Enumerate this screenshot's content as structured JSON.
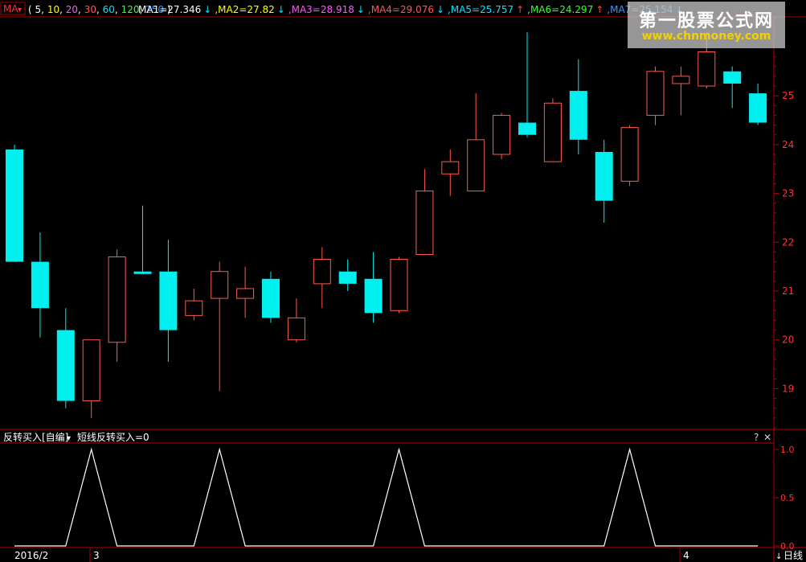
{
  "indicator_bar": {
    "selector": "MA",
    "params_open": "(",
    "params": [
      "5",
      "10",
      "20",
      "30",
      "60",
      "120",
      "250"
    ],
    "params_close": ")",
    "ma": [
      {
        "label": "MA1=27.346",
        "arrow": "↓",
        "color": "#ffffff",
        "arrow_color": "#00e5ff"
      },
      {
        "label": ",MA2=27.82",
        "arrow": "↓",
        "color": "#ffff00",
        "arrow_color": "#00e5ff"
      },
      {
        "label": ",MA3=28.918",
        "arrow": "↓",
        "color": "#ff55ff",
        "arrow_color": "#00e5ff"
      },
      {
        "label": ",MA4=29.076",
        "arrow": "↓",
        "color": "#ff5555",
        "arrow_color": "#00e5ff"
      },
      {
        "label": ",MA5=25.757",
        "arrow": "↑",
        "color": "#00e5ff",
        "arrow_color": "#ff4444"
      },
      {
        "label": ",MA6=24.297",
        "arrow": "↑",
        "color": "#33ff33",
        "arrow_color": "#ff4444"
      },
      {
        "label": ",MA7=25.154",
        "arrow": "↓",
        "color": "#3399ff",
        "arrow_color": "#00e5ff"
      }
    ],
    "param_colors": [
      "#ffffff",
      "#ffff00",
      "#ff55ff",
      "#ff5555",
      "#00e5ff",
      "#33ff33",
      "#3399ff"
    ]
  },
  "watermark": {
    "line1": "第一股票公式网",
    "line2": "www.chnmoney.com"
  },
  "sub_panel": {
    "title": "反转买入[自编]",
    "dropdown": "▾",
    "formula": "短线反转买入=0",
    "help": "?",
    "close": "✕"
  },
  "footer": {
    "labels": [
      "2016/2",
      "3",
      "4"
    ],
    "period": "日线",
    "period_arrow": "🡇"
  },
  "colors": {
    "up": "#ff5a4a",
    "down": "#00f0f0",
    "grid": "#b00000",
    "axis_text": "#ff3333",
    "signal": "#ffffff"
  },
  "chart_data": [
    {
      "type": "candlestick",
      "y_ticks": [
        "19",
        "20",
        "21",
        "22",
        "23",
        "24",
        "25"
      ],
      "ylim": [
        18.2,
        26.6
      ],
      "candles": [
        {
          "o": 23.9,
          "h": 24.0,
          "l": 21.6,
          "c": 21.6
        },
        {
          "o": 21.6,
          "h": 22.2,
          "l": 20.05,
          "c": 20.65
        },
        {
          "o": 20.2,
          "h": 20.65,
          "l": 18.6,
          "c": 18.75
        },
        {
          "o": 18.75,
          "h": 20.0,
          "l": 18.4,
          "c": 20.0
        },
        {
          "o": 19.95,
          "h": 21.85,
          "l": 19.55,
          "c": 21.7
        },
        {
          "o": 21.4,
          "h": 22.75,
          "l": 21.35,
          "c": 21.35
        },
        {
          "o": 21.4,
          "h": 22.05,
          "l": 19.55,
          "c": 20.2
        },
        {
          "o": 20.5,
          "h": 21.05,
          "l": 20.4,
          "c": 20.8
        },
        {
          "o": 20.85,
          "h": 21.6,
          "l": 18.95,
          "c": 21.4
        },
        {
          "o": 20.85,
          "h": 21.5,
          "l": 20.45,
          "c": 21.05
        },
        {
          "o": 21.25,
          "h": 21.4,
          "l": 20.35,
          "c": 20.45
        },
        {
          "o": 20.0,
          "h": 20.85,
          "l": 19.95,
          "c": 20.45
        },
        {
          "o": 21.15,
          "h": 21.9,
          "l": 20.65,
          "c": 21.65
        },
        {
          "o": 21.4,
          "h": 21.65,
          "l": 21.0,
          "c": 21.15
        },
        {
          "o": 21.25,
          "h": 21.8,
          "l": 20.35,
          "c": 20.55
        },
        {
          "o": 20.6,
          "h": 21.7,
          "l": 20.55,
          "c": 21.65
        },
        {
          "o": 21.75,
          "h": 23.5,
          "l": 21.75,
          "c": 23.05
        },
        {
          "o": 23.4,
          "h": 23.9,
          "l": 22.95,
          "c": 23.65
        },
        {
          "o": 23.05,
          "h": 25.05,
          "l": 23.05,
          "c": 24.1
        },
        {
          "o": 23.8,
          "h": 24.65,
          "l": 23.7,
          "c": 24.6
        },
        {
          "o": 24.45,
          "h": 26.3,
          "l": 24.15,
          "c": 24.2
        },
        {
          "o": 23.65,
          "h": 24.95,
          "l": 23.65,
          "c": 24.85
        },
        {
          "o": 25.1,
          "h": 25.75,
          "l": 23.8,
          "c": 24.1
        },
        {
          "o": 23.85,
          "h": 24.1,
          "l": 22.4,
          "c": 22.85
        },
        {
          "o": 23.25,
          "h": 24.4,
          "l": 23.15,
          "c": 24.35
        },
        {
          "o": 24.6,
          "h": 25.6,
          "l": 24.4,
          "c": 25.5
        },
        {
          "o": 25.25,
          "h": 25.6,
          "l": 24.6,
          "c": 25.4
        },
        {
          "o": 25.2,
          "h": 26.3,
          "l": 25.15,
          "c": 25.9
        },
        {
          "o": 25.5,
          "h": 25.6,
          "l": 24.75,
          "c": 25.25
        },
        {
          "o": 25.05,
          "h": 25.25,
          "l": 24.4,
          "c": 24.45
        }
      ]
    },
    {
      "type": "line",
      "name": "短线反转买入",
      "y_ticks": [
        "1.0",
        "0.5",
        "0.0"
      ],
      "ylim": [
        0,
        1
      ],
      "values": [
        0,
        0,
        0,
        1,
        0,
        0,
        0,
        0,
        1,
        0,
        0,
        0,
        0,
        0,
        0,
        1,
        0,
        0,
        0,
        0,
        0,
        0,
        0,
        0,
        1,
        0,
        0,
        0,
        0,
        0
      ]
    }
  ]
}
